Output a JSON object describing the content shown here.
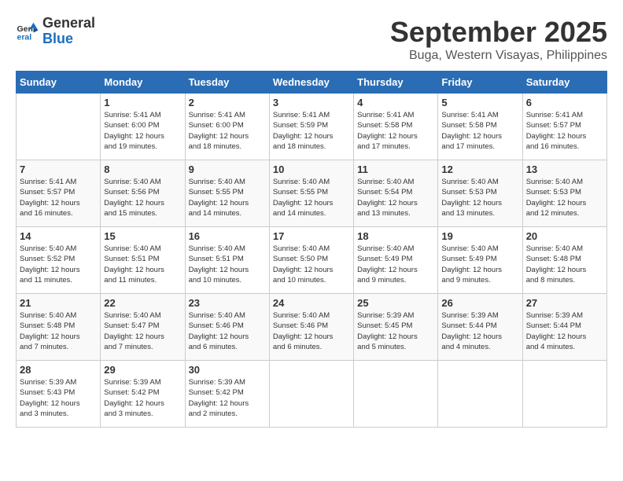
{
  "header": {
    "logo_general": "General",
    "logo_blue": "Blue",
    "month": "September 2025",
    "location": "Buga, Western Visayas, Philippines"
  },
  "weekdays": [
    "Sunday",
    "Monday",
    "Tuesday",
    "Wednesday",
    "Thursday",
    "Friday",
    "Saturday"
  ],
  "weeks": [
    [
      {
        "day": "",
        "info": ""
      },
      {
        "day": "1",
        "info": "Sunrise: 5:41 AM\nSunset: 6:00 PM\nDaylight: 12 hours\nand 19 minutes."
      },
      {
        "day": "2",
        "info": "Sunrise: 5:41 AM\nSunset: 6:00 PM\nDaylight: 12 hours\nand 18 minutes."
      },
      {
        "day": "3",
        "info": "Sunrise: 5:41 AM\nSunset: 5:59 PM\nDaylight: 12 hours\nand 18 minutes."
      },
      {
        "day": "4",
        "info": "Sunrise: 5:41 AM\nSunset: 5:58 PM\nDaylight: 12 hours\nand 17 minutes."
      },
      {
        "day": "5",
        "info": "Sunrise: 5:41 AM\nSunset: 5:58 PM\nDaylight: 12 hours\nand 17 minutes."
      },
      {
        "day": "6",
        "info": "Sunrise: 5:41 AM\nSunset: 5:57 PM\nDaylight: 12 hours\nand 16 minutes."
      }
    ],
    [
      {
        "day": "7",
        "info": "Sunrise: 5:41 AM\nSunset: 5:57 PM\nDaylight: 12 hours\nand 16 minutes."
      },
      {
        "day": "8",
        "info": "Sunrise: 5:40 AM\nSunset: 5:56 PM\nDaylight: 12 hours\nand 15 minutes."
      },
      {
        "day": "9",
        "info": "Sunrise: 5:40 AM\nSunset: 5:55 PM\nDaylight: 12 hours\nand 14 minutes."
      },
      {
        "day": "10",
        "info": "Sunrise: 5:40 AM\nSunset: 5:55 PM\nDaylight: 12 hours\nand 14 minutes."
      },
      {
        "day": "11",
        "info": "Sunrise: 5:40 AM\nSunset: 5:54 PM\nDaylight: 12 hours\nand 13 minutes."
      },
      {
        "day": "12",
        "info": "Sunrise: 5:40 AM\nSunset: 5:53 PM\nDaylight: 12 hours\nand 13 minutes."
      },
      {
        "day": "13",
        "info": "Sunrise: 5:40 AM\nSunset: 5:53 PM\nDaylight: 12 hours\nand 12 minutes."
      }
    ],
    [
      {
        "day": "14",
        "info": "Sunrise: 5:40 AM\nSunset: 5:52 PM\nDaylight: 12 hours\nand 11 minutes."
      },
      {
        "day": "15",
        "info": "Sunrise: 5:40 AM\nSunset: 5:51 PM\nDaylight: 12 hours\nand 11 minutes."
      },
      {
        "day": "16",
        "info": "Sunrise: 5:40 AM\nSunset: 5:51 PM\nDaylight: 12 hours\nand 10 minutes."
      },
      {
        "day": "17",
        "info": "Sunrise: 5:40 AM\nSunset: 5:50 PM\nDaylight: 12 hours\nand 10 minutes."
      },
      {
        "day": "18",
        "info": "Sunrise: 5:40 AM\nSunset: 5:49 PM\nDaylight: 12 hours\nand 9 minutes."
      },
      {
        "day": "19",
        "info": "Sunrise: 5:40 AM\nSunset: 5:49 PM\nDaylight: 12 hours\nand 9 minutes."
      },
      {
        "day": "20",
        "info": "Sunrise: 5:40 AM\nSunset: 5:48 PM\nDaylight: 12 hours\nand 8 minutes."
      }
    ],
    [
      {
        "day": "21",
        "info": "Sunrise: 5:40 AM\nSunset: 5:48 PM\nDaylight: 12 hours\nand 7 minutes."
      },
      {
        "day": "22",
        "info": "Sunrise: 5:40 AM\nSunset: 5:47 PM\nDaylight: 12 hours\nand 7 minutes."
      },
      {
        "day": "23",
        "info": "Sunrise: 5:40 AM\nSunset: 5:46 PM\nDaylight: 12 hours\nand 6 minutes."
      },
      {
        "day": "24",
        "info": "Sunrise: 5:40 AM\nSunset: 5:46 PM\nDaylight: 12 hours\nand 6 minutes."
      },
      {
        "day": "25",
        "info": "Sunrise: 5:39 AM\nSunset: 5:45 PM\nDaylight: 12 hours\nand 5 minutes."
      },
      {
        "day": "26",
        "info": "Sunrise: 5:39 AM\nSunset: 5:44 PM\nDaylight: 12 hours\nand 4 minutes."
      },
      {
        "day": "27",
        "info": "Sunrise: 5:39 AM\nSunset: 5:44 PM\nDaylight: 12 hours\nand 4 minutes."
      }
    ],
    [
      {
        "day": "28",
        "info": "Sunrise: 5:39 AM\nSunset: 5:43 PM\nDaylight: 12 hours\nand 3 minutes."
      },
      {
        "day": "29",
        "info": "Sunrise: 5:39 AM\nSunset: 5:42 PM\nDaylight: 12 hours\nand 3 minutes."
      },
      {
        "day": "30",
        "info": "Sunrise: 5:39 AM\nSunset: 5:42 PM\nDaylight: 12 hours\nand 2 minutes."
      },
      {
        "day": "",
        "info": ""
      },
      {
        "day": "",
        "info": ""
      },
      {
        "day": "",
        "info": ""
      },
      {
        "day": "",
        "info": ""
      }
    ]
  ]
}
